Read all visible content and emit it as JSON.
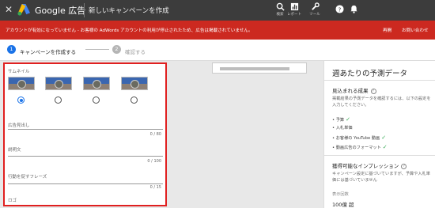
{
  "topbar": {
    "brand": "Google 広告",
    "page_title": "新しいキャンペーンを作成",
    "tools": [
      {
        "icon": "search-icon",
        "label": "検索"
      },
      {
        "icon": "reports-icon",
        "label": "レポート"
      },
      {
        "icon": "wrench-icon",
        "label": "ツール"
      }
    ],
    "help_icon": "help-icon",
    "notify_icon": "bell-icon"
  },
  "alert": {
    "message": "アカウントが有効になっていません - お客様の AdWords アカウントの利用が停止されたため、広告は掲載されていません。",
    "action1": "再開",
    "action2": "お問い合わせ",
    "color": "#cc2920"
  },
  "stepper": {
    "step1_num": "1",
    "step1_label": "キャンペーンを作成する",
    "step2_num": "2",
    "step2_label": "確認する",
    "accent": "#1a73e8"
  },
  "form": {
    "thumbnail_label": "サムネイル",
    "thumbnails_selected": 0,
    "headline_label": "広告見出し",
    "headline_counter": "0 / 80",
    "description_label": "説明文",
    "description_counter": "0 / 100",
    "cta_label": "行動を促すフレーズ",
    "cta_counter": "0 / 15",
    "logo_label": "ロゴ"
  },
  "panel": {
    "title": "週あたりの予測データ",
    "results_heading": "見込まれる成果",
    "results_text": "掲載結果の予測データを確認するには、以下の設定を入力してください。",
    "items": [
      {
        "label": "予算",
        "checked": true
      },
      {
        "label": "入札単価",
        "checked": false
      },
      {
        "label": "お客様の YouTube 動画",
        "checked": true
      },
      {
        "label": "動画広告のフォーマット",
        "checked": true
      }
    ],
    "impressions_heading": "獲得可能なインプレッション",
    "impressions_text": "キャンペーン設定に基づいていますが、予算や入札単価には基づいていません",
    "display_count_label": "表示回数",
    "display_count_value": "100億 超"
  }
}
